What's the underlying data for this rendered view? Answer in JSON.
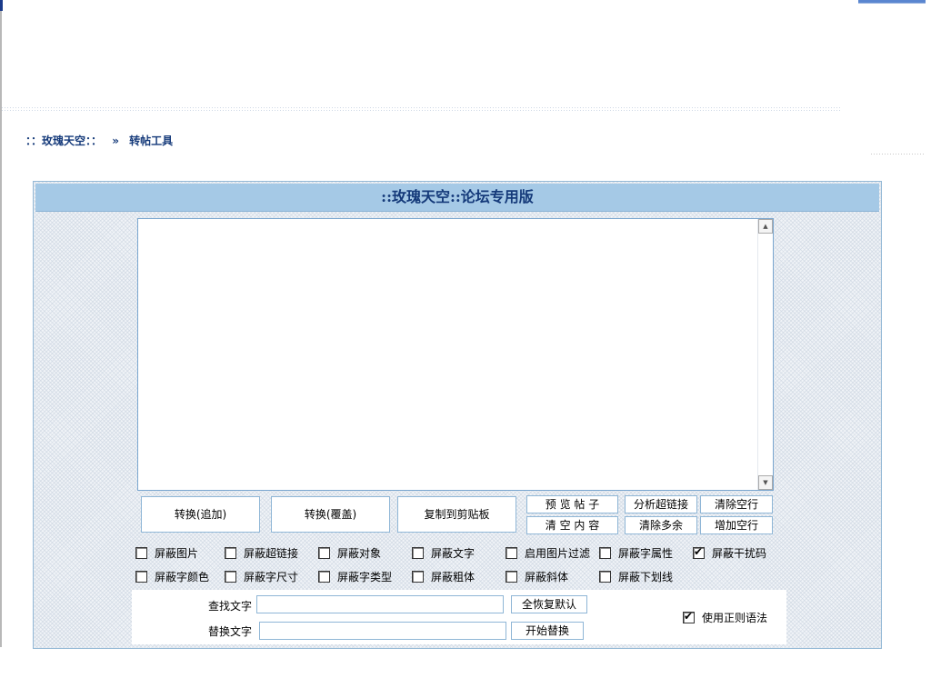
{
  "breadcrumb": {
    "site": "：：玫瑰天空：：",
    "separator": "»",
    "current": "转帖工具"
  },
  "panel": {
    "title": "::玫瑰天空::论坛专用版"
  },
  "editor": {
    "value": ""
  },
  "buttons": {
    "convert_append": "转换(追加)",
    "convert_overwrite": "转换(覆盖)",
    "copy_clipboard": "复制到剪贴板",
    "preview_post": "预 览 帖 子",
    "clear_content": "清 空 内 容",
    "analyze_links": "分析超链接",
    "clear_extra": "清除多余",
    "clear_blank_lines": "清除空行",
    "add_blank_lines": "增加空行",
    "restore_defaults": "全恢复默认",
    "start_replace": "开始替换"
  },
  "options": {
    "row1": [
      {
        "label": "屏蔽图片",
        "checked": false
      },
      {
        "label": "屏蔽超链接",
        "checked": false
      },
      {
        "label": "屏蔽对象",
        "checked": false
      },
      {
        "label": "屏蔽文字",
        "checked": false
      },
      {
        "label": "启用图片过滤",
        "checked": false
      },
      {
        "label": "屏蔽字属性",
        "checked": false
      },
      {
        "label": "屏蔽干扰码",
        "checked": true
      }
    ],
    "row2": [
      {
        "label": "屏蔽字颜色",
        "checked": false
      },
      {
        "label": "屏蔽字尺寸",
        "checked": false
      },
      {
        "label": "屏蔽字类型",
        "checked": false
      },
      {
        "label": "屏蔽粗体",
        "checked": false
      },
      {
        "label": "屏蔽斜体",
        "checked": false
      },
      {
        "label": "屏蔽下划线",
        "checked": false
      }
    ]
  },
  "search": {
    "find_label": "查找文字",
    "find_value": "",
    "replace_label": "替换文字",
    "replace_value": "",
    "regex_label": "使用正则语法",
    "regex_checked": true
  }
}
